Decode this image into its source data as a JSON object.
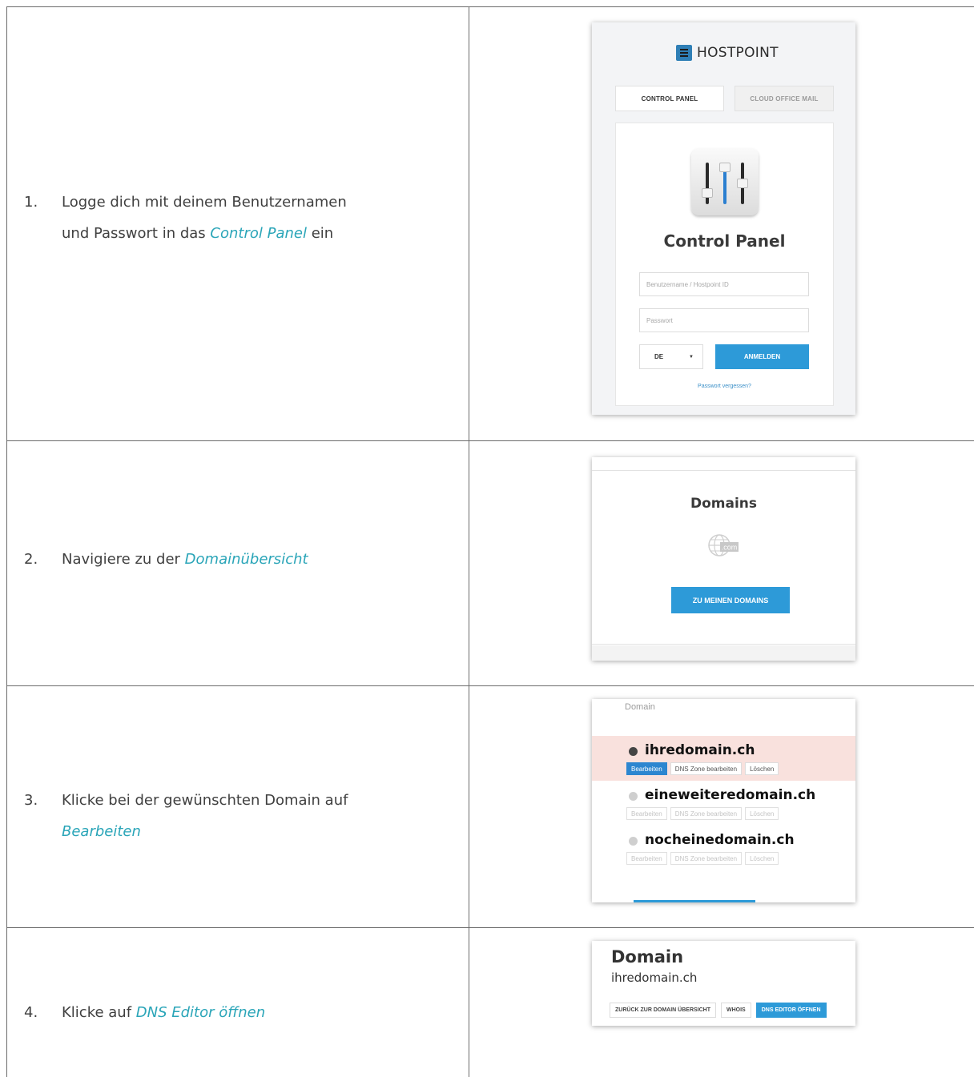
{
  "steps": [
    {
      "num": "1.",
      "line1": "Logge dich mit deinem Benutzernamen",
      "line2_before": "und Passwort in das ",
      "link": "Control Panel",
      "line2_after": " ein"
    },
    {
      "num": "2.",
      "before": "Navigiere zu der ",
      "link": "Domainübersicht"
    },
    {
      "num": "3.",
      "line1": "Klicke bei der gewünschten Domain auf",
      "link": "Bearbeiten"
    },
    {
      "num": "4.",
      "before": "Klicke auf ",
      "link": "DNS Editor öffnen"
    }
  ],
  "login": {
    "brand": "HOSTPOINT",
    "tab_control_panel": "CONTROL PANEL",
    "tab_cloud_office_mail": "CLOUD OFFICE MAIL",
    "title": "Control Panel",
    "username_placeholder": "Benutzername / Hostpoint ID",
    "password_placeholder": "Passwort",
    "language": "DE",
    "login_button": "ANMELDEN",
    "forgot_link": "Passwort vergessen?"
  },
  "domains_panel": {
    "title": "Domains",
    "globe_label": ".com",
    "button": "ZU MEINEN DOMAINS"
  },
  "domain_list": {
    "header": "Domain",
    "rows": [
      {
        "name": "ihredomain.ch",
        "selected": true
      },
      {
        "name": "eineweiteredomain.ch",
        "selected": false
      },
      {
        "name": "nocheinedomain.ch",
        "selected": false
      }
    ],
    "btn_edit": "Bearbeiten",
    "btn_dns": "DNS Zone bearbeiten",
    "btn_delete": "Löschen"
  },
  "domain_detail": {
    "title": "Domain",
    "domain": "ihredomain.ch",
    "btn_back": "ZURÜCK ZUR DOMAIN ÜBERSICHT",
    "btn_whois": "WHOIS",
    "btn_dns_editor": "DNS EDITOR ÖFFNEN"
  },
  "colors": {
    "link": "#2aa5b8",
    "primary_button": "#2d9ad8",
    "selected_row": "#f9e1dd",
    "brand_logo": "#2f7fb6"
  }
}
